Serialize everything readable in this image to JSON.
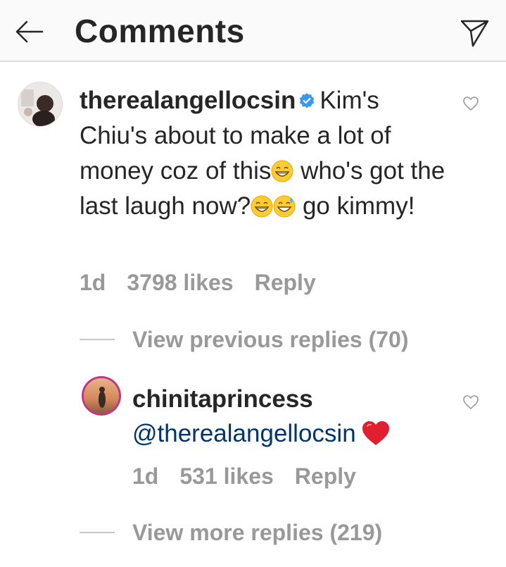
{
  "header": {
    "title": "Comments",
    "back_icon": "arrow-left-icon",
    "send_icon": "paper-plane-icon"
  },
  "comment": {
    "username": "therealangellocsin",
    "verified": true,
    "text_part1": "Kim's Chiu's about to make a lot of money coz of this",
    "text_part2": " who's got the last laugh now?",
    "text_part3": " go kimmy!",
    "time": "1d",
    "likes": "3798 likes",
    "reply_label": "Reply"
  },
  "view_previous": "View previous replies (70)",
  "reply": {
    "username": "chinitaprincess",
    "mention": "@therealangellocsin",
    "time": "1d",
    "likes": "531 likes",
    "reply_label": "Reply"
  },
  "view_more": "View more replies (219)",
  "colors": {
    "verified": "#3897f0",
    "mention": "#003569",
    "meta": "#999999",
    "heart_emoji": "#e02030"
  }
}
